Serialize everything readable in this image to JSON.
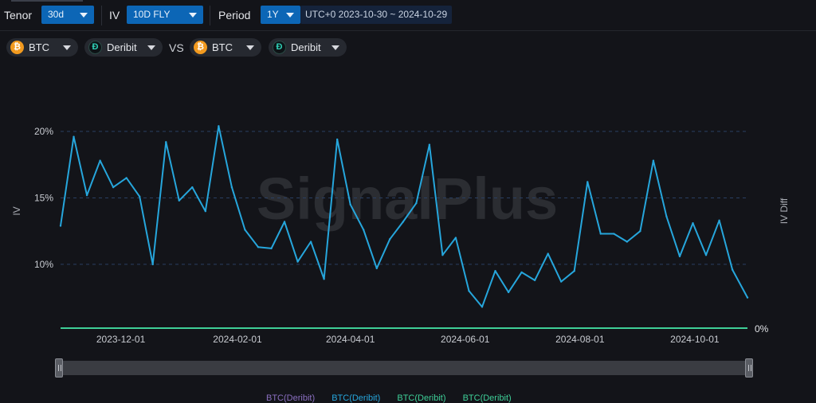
{
  "toolbar": {
    "tenor_label": "Tenor",
    "tenor_value": "30d",
    "iv_label": "IV",
    "iv_value": "10D FLY",
    "period_label": "Period",
    "period_value": "1Y",
    "range_text": "UTC+0 2023-10-30 ~ 2024-10-29"
  },
  "compare": {
    "left_asset": "BTC",
    "left_exchange": "Deribit",
    "vs_label": "VS",
    "right_asset": "BTC",
    "right_exchange": "Deribit"
  },
  "watermark": "SignalPlus",
  "colors": {
    "iv_line": "#26a6dc",
    "diff_line": "#3ecf98",
    "grid": "#2a3f63",
    "btc_icon": "#f29a1f",
    "deribit_icon": "#2fd0b6",
    "select_bg": "#0c66b6"
  },
  "icons": {
    "asset": "bitcoin-icon",
    "exchange": "deribit-icon"
  },
  "legend": [
    {
      "label": "BTC(Deribit)",
      "color": "#8a6fc0"
    },
    {
      "label": "BTC(Deribit)",
      "color": "#26a6dc"
    },
    {
      "label": "BTC(Deribit)",
      "color": "#3ecf98"
    },
    {
      "label": "BTC(Deribit)",
      "color": "#3ecf98"
    }
  ],
  "chart_data": {
    "type": "line",
    "ylabel": "IV",
    "y2label": "IV Diff",
    "y_ticks": [
      "10%",
      "15%",
      "20%"
    ],
    "y2_ticks": [
      "0%"
    ],
    "x_ticks": [
      "2023-12-01",
      "2024-02-01",
      "2024-04-01",
      "2024-06-01",
      "2024-08-01",
      "2024-10-01"
    ],
    "x_range": [
      "2023-10-30",
      "2024-10-29"
    ],
    "ylim": [
      5.2,
      21.5
    ],
    "grid": "horizontal dashed",
    "series": [
      {
        "type": "iv",
        "x": [
          "2023-10-30",
          "2023-11-06",
          "2023-11-13",
          "2023-11-20",
          "2023-11-27",
          "2023-12-04",
          "2023-12-11",
          "2023-12-18",
          "2023-12-25",
          "2024-01-01",
          "2024-01-08",
          "2024-01-15",
          "2024-01-22",
          "2024-01-29",
          "2024-02-05",
          "2024-02-12",
          "2024-02-19",
          "2024-02-26",
          "2024-03-04",
          "2024-03-11",
          "2024-03-18",
          "2024-03-25",
          "2024-04-01",
          "2024-04-08",
          "2024-04-15",
          "2024-04-22",
          "2024-04-29",
          "2024-05-06",
          "2024-05-13",
          "2024-05-20",
          "2024-05-27",
          "2024-06-03",
          "2024-06-10",
          "2024-06-17",
          "2024-06-24",
          "2024-07-01",
          "2024-07-08",
          "2024-07-15",
          "2024-07-22",
          "2024-07-29",
          "2024-08-05",
          "2024-08-12",
          "2024-08-19",
          "2024-08-26",
          "2024-09-02",
          "2024-09-09",
          "2024-09-16",
          "2024-09-23",
          "2024-09-30",
          "2024-10-07",
          "2024-10-14",
          "2024-10-21",
          "2024-10-29"
        ],
        "values": [
          12.9,
          19.6,
          15.2,
          17.8,
          15.8,
          16.5,
          15.1,
          10.0,
          19.2,
          14.8,
          15.8,
          14.0,
          20.4,
          15.8,
          12.6,
          11.3,
          11.2,
          13.2,
          10.2,
          11.7,
          8.9,
          19.4,
          14.5,
          12.6,
          9.7,
          11.9,
          13.2,
          14.6,
          19.0,
          10.7,
          12.0,
          8.0,
          6.8,
          9.5,
          7.9,
          9.4,
          8.8,
          10.8,
          8.7,
          9.5,
          16.2,
          12.3,
          12.3,
          11.7,
          12.5,
          17.8,
          13.6,
          10.6,
          13.1,
          10.7,
          13.3,
          9.6,
          7.5
        ]
      },
      {
        "type": "iv_diff",
        "x": [
          "2023-10-30",
          "2024-10-29"
        ],
        "values": [
          0,
          0
        ]
      }
    ]
  }
}
